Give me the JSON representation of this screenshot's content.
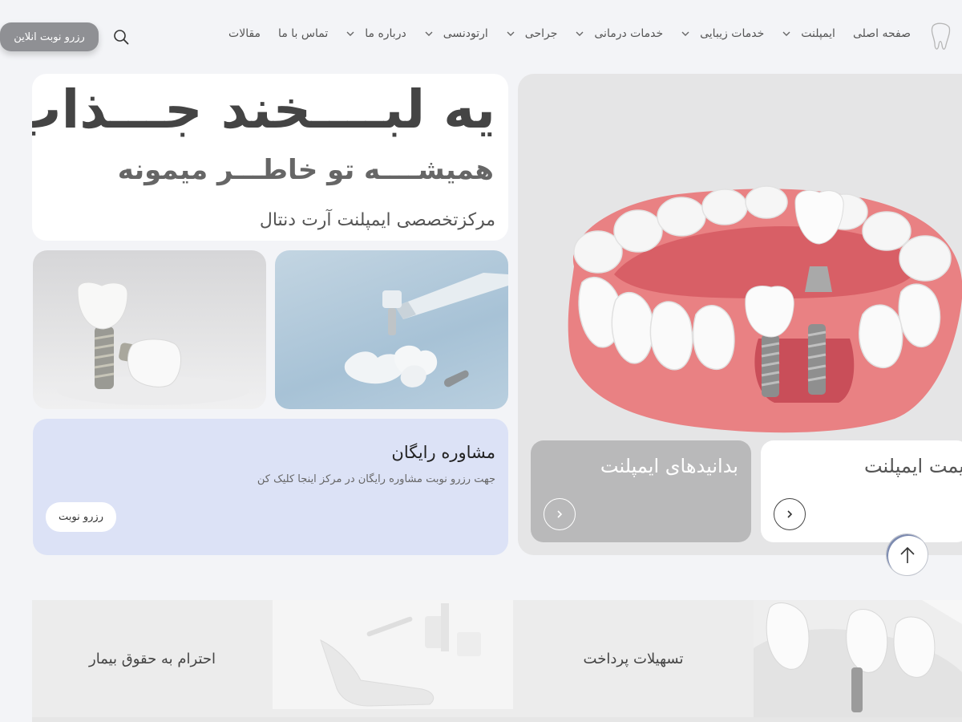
{
  "header": {
    "nav": [
      {
        "label": "صفحه اصلی",
        "dropdown": false
      },
      {
        "label": "ایمپلنت",
        "dropdown": true
      },
      {
        "label": "خدمات زیبایی",
        "dropdown": true
      },
      {
        "label": "خدمات درمانی",
        "dropdown": true
      },
      {
        "label": "جراحی",
        "dropdown": true
      },
      {
        "label": "ارتودنسی",
        "dropdown": true
      },
      {
        "label": "درباره ما",
        "dropdown": true
      },
      {
        "label": "تماس با ما",
        "dropdown": false
      },
      {
        "label": "مقالات",
        "dropdown": false
      }
    ],
    "search_icon": "search-icon",
    "book_online_label": "رزرو نوبت انلاین"
  },
  "hero": {
    "title": "یه لبــــخند جـــذاب",
    "subtitle": "همیشــــه تو خاطـــر میمونه",
    "tagline": "مرکزتخصصی ایمپلنت آرت دنتال"
  },
  "consult": {
    "title": "مشاوره رایگان",
    "description": "جهت رزرو نوبت مشاوره رایگان در مرکز اینجا کلیک کن",
    "button_label": "رزرو نوبت"
  },
  "slider": {
    "cards": [
      {
        "title": "بدانیدهای ایمپلنت"
      },
      {
        "title": "قیمت ایمپلنت"
      }
    ]
  },
  "features": [
    {
      "label": "تسهیلات پرداخت"
    },
    {
      "label": "احترام به حقوق بیمار"
    }
  ],
  "colors": {
    "page_bg": "#f3f4f7",
    "consult_bg": "#dce2f6",
    "button_gray": "#8f9094",
    "gum_pink": "#e77a7e"
  }
}
